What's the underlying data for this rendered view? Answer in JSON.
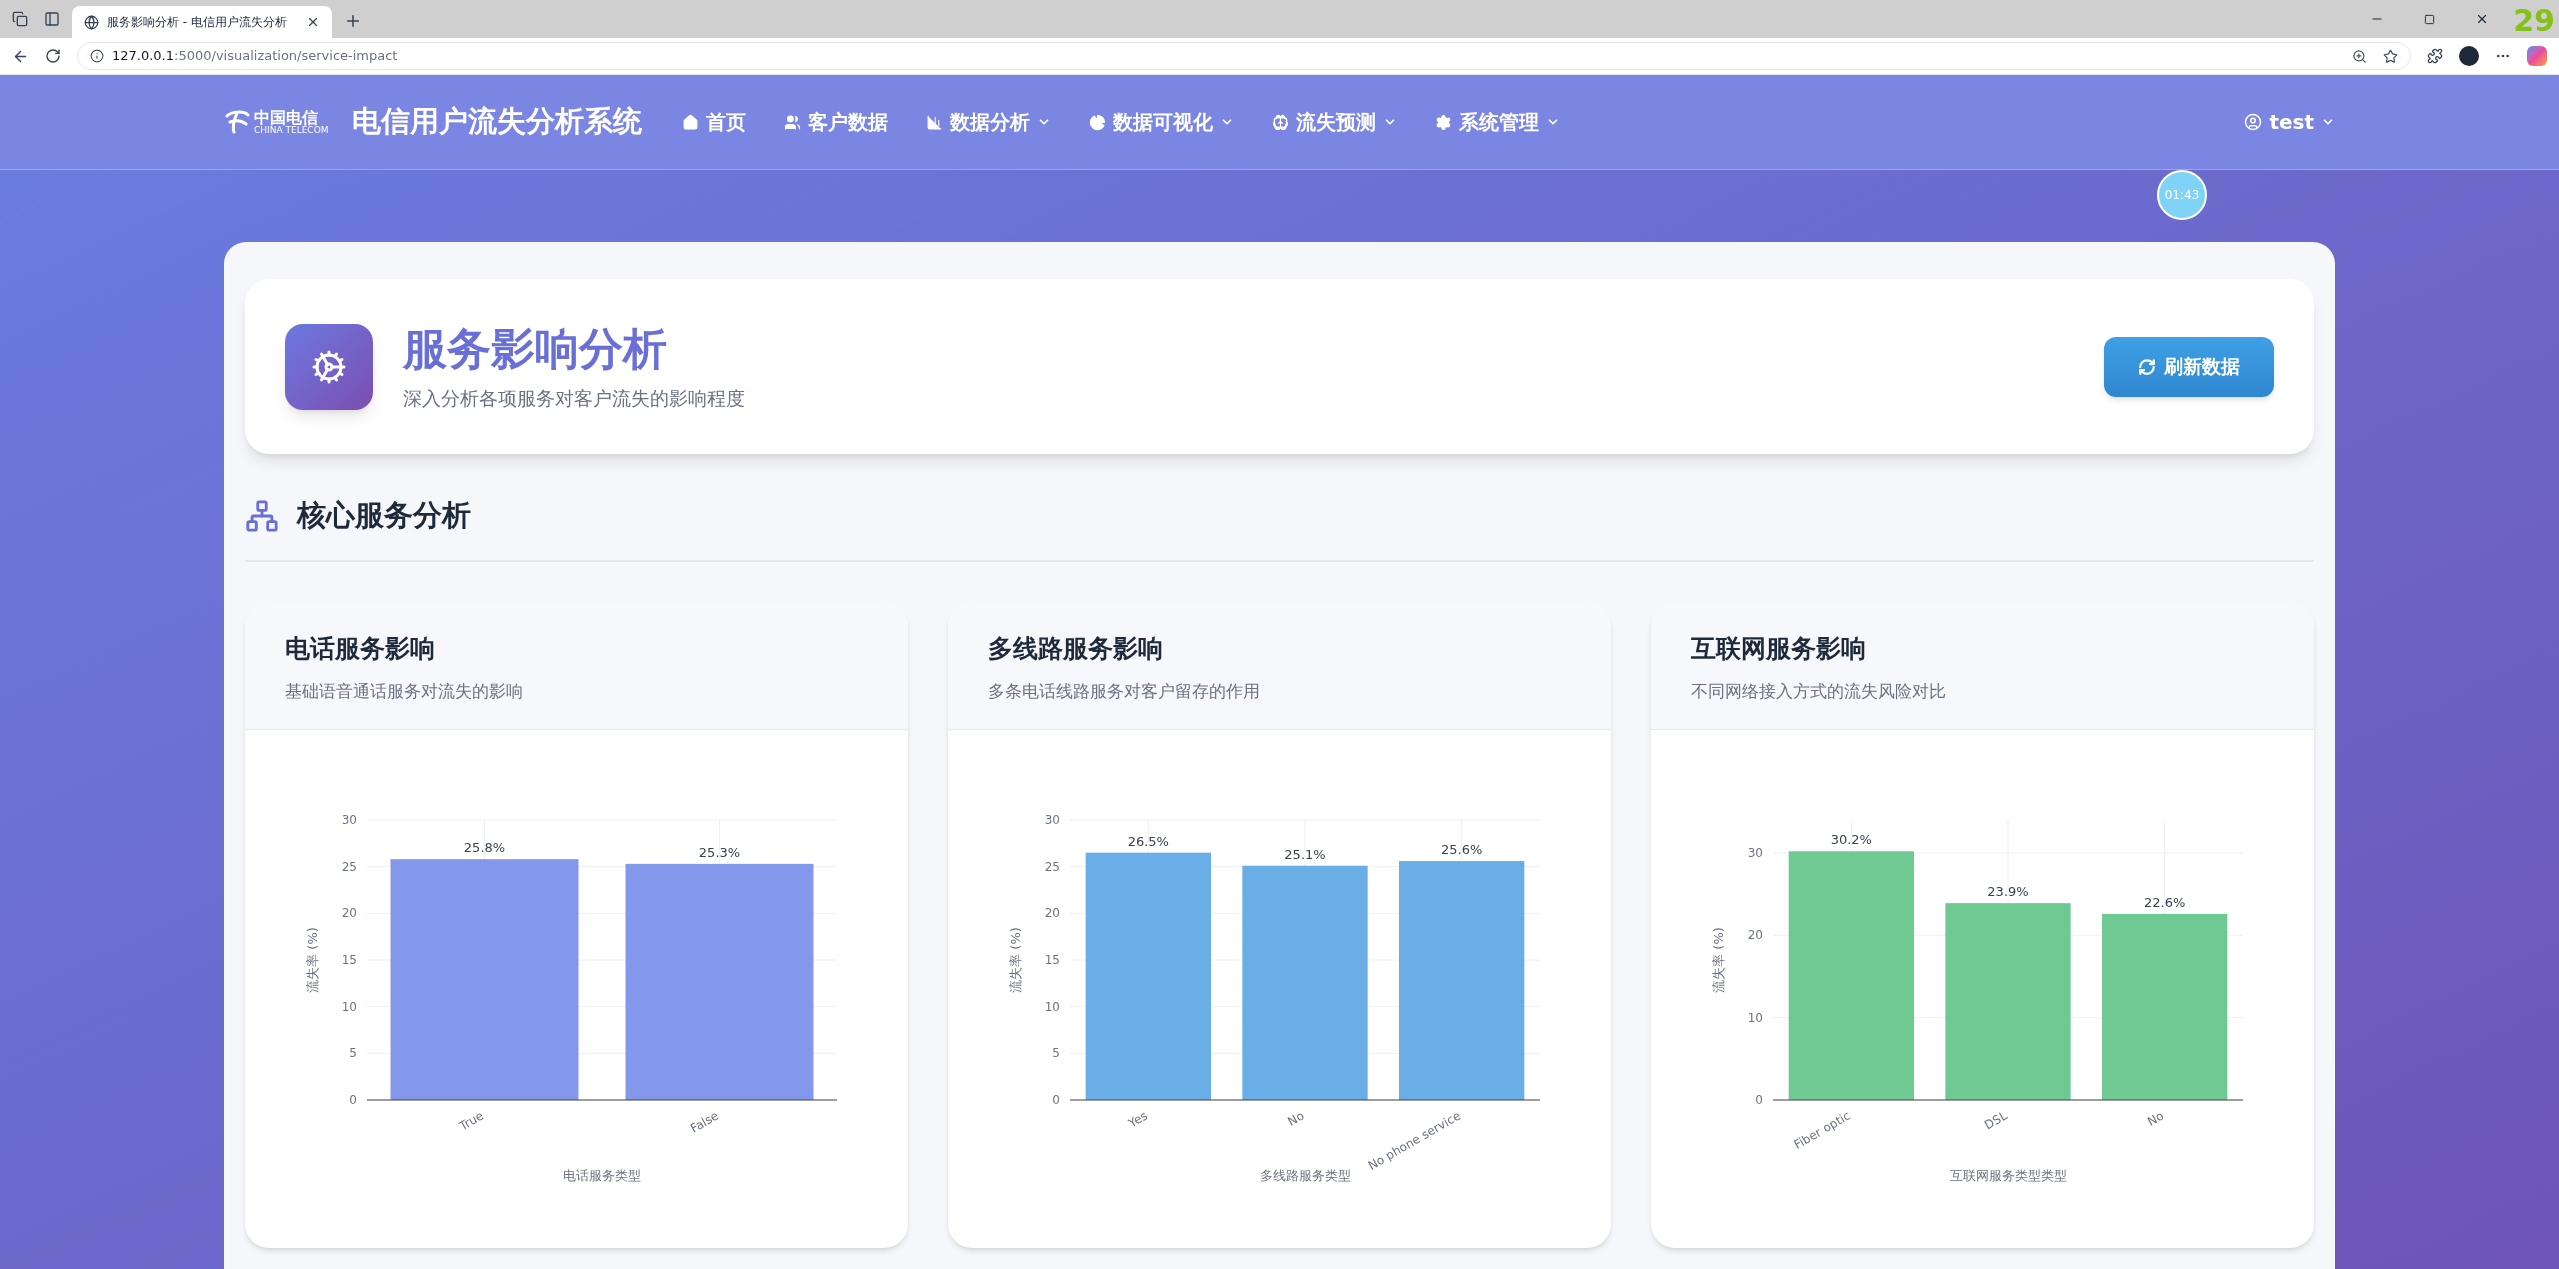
{
  "browser": {
    "tab_title": "服务影响分析 - 电信用户流失分析",
    "url_host": "127.0.0.1",
    "url_path": ":5000/visualization/service-impact",
    "corner_counter": "29"
  },
  "nav": {
    "logo_text": "中国电信",
    "logo_sub": "CHINA TELECOM",
    "title": "电信用户流失分析系统",
    "items": [
      {
        "label": "首页",
        "has_menu": false
      },
      {
        "label": "客户数据",
        "has_menu": false
      },
      {
        "label": "数据分析",
        "has_menu": true
      },
      {
        "label": "数据可视化",
        "has_menu": true
      },
      {
        "label": "流失预测",
        "has_menu": true
      },
      {
        "label": "系统管理",
        "has_menu": true
      }
    ],
    "user": {
      "label": "test",
      "has_menu": true
    }
  },
  "timer": "01:43",
  "header": {
    "title": "服务影响分析",
    "subtitle": "深入分析各项服务对客户流失的影响程度",
    "button": "刷新数据"
  },
  "section": {
    "title": "核心服务分析"
  },
  "charts": [
    {
      "title": "电话服务影响",
      "subtitle": "基础语音通话服务对流失的影响",
      "chart_data": {
        "type": "bar",
        "xlabel": "电话服务类型",
        "ylabel": "流失率 (%)",
        "categories": [
          "True",
          "False"
        ],
        "grid": true,
        "series": [
          {
            "color": "#8397eb",
            "values": [
              25.8,
              25.3
            ]
          }
        ],
        "ylim": [
          0,
          30
        ],
        "yticks": [
          0,
          5,
          10,
          15,
          20,
          25,
          30
        ],
        "value_labels": [
          "25.8%",
          "25.3%"
        ]
      }
    },
    {
      "title": "多线路服务影响",
      "subtitle": "多条电话线路服务对客户留存的作用",
      "chart_data": {
        "type": "bar",
        "xlabel": "多线路服务类型",
        "ylabel": "流失率 (%)",
        "categories": [
          "Yes",
          "No",
          "No phone service"
        ],
        "grid": true,
        "series": [
          {
            "color": "#69aee6",
            "values": [
              26.5,
              25.1,
              25.6
            ]
          }
        ],
        "ylim": [
          0,
          30
        ],
        "yticks": [
          0,
          5,
          10,
          15,
          20,
          25,
          30
        ],
        "value_labels": [
          "26.5%",
          "25.1%",
          "25.6%"
        ]
      }
    },
    {
      "title": "互联网服务影响",
      "subtitle": "不同网络接入方式的流失风险对比",
      "chart_data": {
        "type": "bar",
        "xlabel": "互联网服务类型类型",
        "ylabel": "流失率 (%)",
        "categories": [
          "Fiber optic",
          "DSL",
          "No"
        ],
        "grid": true,
        "series": [
          {
            "color": "#6fc993",
            "values": [
              30.2,
              23.9,
              22.6
            ]
          }
        ],
        "ylim": [
          0,
          34
        ],
        "yticks": [
          0,
          10,
          20,
          30
        ],
        "value_labels": [
          "30.2%",
          "23.9%",
          "22.6%"
        ]
      }
    }
  ]
}
